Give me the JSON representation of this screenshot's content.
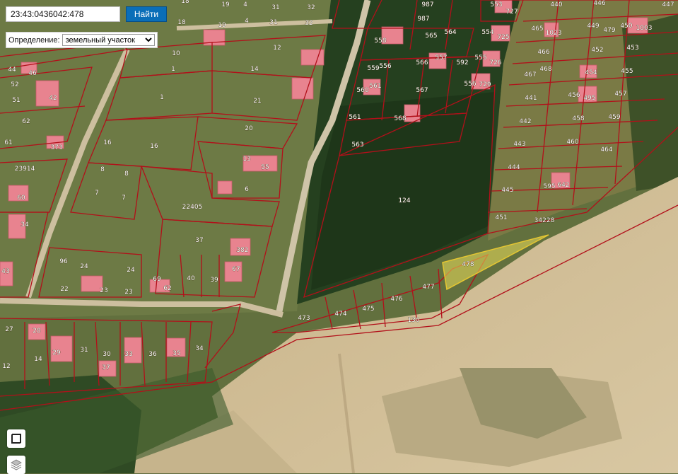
{
  "search": {
    "value": "23:43:0436042:478",
    "button_label": "Найти"
  },
  "definition": {
    "label": "Определение:",
    "selected": "земельный участок"
  },
  "colors": {
    "parcel_border": "#b2101a",
    "selected_parcel": "#ece05a",
    "building": "#e8838f"
  },
  "controls": {
    "area_tool_icon": "square-outline-icon",
    "layers_icon": "layers-icon"
  },
  "parcel_labels": {
    "p18a": "18",
    "p19a": "19",
    "p4a": "4",
    "p31a": "31",
    "p32a": "32",
    "p18b": "18",
    "p19b": "19",
    "p4b": "4",
    "p31b": "31",
    "p32b": "32",
    "p10": "10",
    "p12": "12",
    "p1a": "1",
    "p14": "14",
    "p1b": "1",
    "p21": "21",
    "p44": "44",
    "p46": "46",
    "p52": "52",
    "p42": "42",
    "p51": "51",
    "p62": "62",
    "p61": "61",
    "p373": "373",
    "p16a": "16",
    "p16b": "16",
    "p20": "20",
    "p13": "13",
    "p55": "55",
    "p23914": "23914",
    "p8a": "8",
    "p8b": "8",
    "p7a": "7",
    "p7b": "7",
    "p6": "6",
    "p60": "60",
    "p34a": "34",
    "p22405": "22405",
    "p37": "37",
    "p382": "382",
    "p96": "96",
    "p24a": "24",
    "p24b": "24",
    "p22": "22",
    "p23a": "23",
    "p23b": "23",
    "p69": "69",
    "p62b": "62",
    "p40": "40",
    "p39": "39",
    "p67": "67",
    "p43": "43",
    "p987a": "987",
    "p987b": "987",
    "p553": "553",
    "p727": "727",
    "p440": "440",
    "p446": "446",
    "p447": "447",
    "p558": "558",
    "p565": "565",
    "p564": "564",
    "p554": "554",
    "p725": "725",
    "p465": "465",
    "p1023": "1023",
    "p449": "449",
    "p479": "479",
    "p450": "450",
    "p1003": "1003",
    "p566": "566",
    "p557": "557",
    "p592": "592",
    "p559": "559",
    "p556b": "556",
    "p555": "555",
    "p726": "726",
    "p466": "466",
    "p452": "452",
    "p453": "453",
    "p467": "467",
    "p468": "468",
    "p454": "454",
    "p455": "455",
    "p560": "560",
    "p561b": "561",
    "p567": "567",
    "p556": "556",
    "p729": "729",
    "p441": "441",
    "p456": "456",
    "p495": "495",
    "p457": "457",
    "p561": "561",
    "p568": "568",
    "p563": "563",
    "p442": "442",
    "p458": "458",
    "p459": "459",
    "p443": "443",
    "p460": "460",
    "p464": "464",
    "p124": "124",
    "p444": "444",
    "p595": "595",
    "p642": "642",
    "p445": "445",
    "p451": "451",
    "p34228": "34228",
    "p478": "478",
    "p477": "477",
    "p476": "476",
    "p475": "475",
    "p474": "474",
    "p473": "473",
    "p130": "130",
    "p27": "27",
    "p28": "28",
    "p29": "29",
    "p31c": "31",
    "p30": "30",
    "p33": "33",
    "p36": "36",
    "p35": "35",
    "p34b": "34",
    "p14b": "14",
    "p12b": "12",
    "p37b": "37"
  }
}
